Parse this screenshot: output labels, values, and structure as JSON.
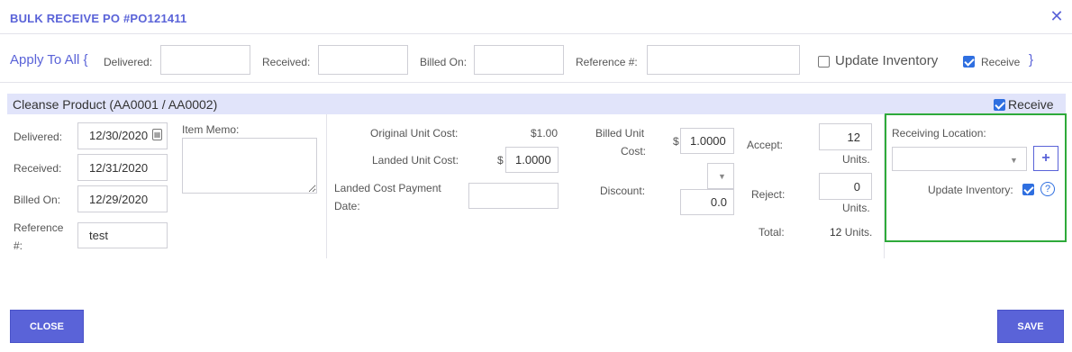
{
  "modal": {
    "title": "BULK RECEIVE PO #PO121411",
    "close_icon": "close-icon"
  },
  "apply_all": {
    "label": "Apply To All",
    "open_brace": "{",
    "close_brace": "}",
    "delivered_label": "Delivered:",
    "delivered_value": "",
    "received_label": "Received:",
    "received_value": "",
    "billed_on_label": "Billed On:",
    "billed_on_value": "",
    "reference_label": "Reference #:",
    "reference_value": "",
    "update_inventory_label": "Update Inventory",
    "update_inventory_checked": false,
    "receive_label": "Receive",
    "receive_checked": true
  },
  "product": {
    "title": "Cleanse Product (AA0001 / AA0002)",
    "receive_label": "Receive",
    "receive_checked": true,
    "delivered_label": "Delivered:",
    "delivered_value": "12/30/2020",
    "received_label": "Received:",
    "received_value": "12/31/2020",
    "billed_on_label": "Billed On:",
    "billed_on_value": "12/29/2020",
    "reference_label_1": "Reference",
    "reference_label_2": "#:",
    "reference_value": "test",
    "item_memo_label": "Item Memo:",
    "item_memo_value": "",
    "original_unit_cost_label": "Original Unit Cost:",
    "original_unit_cost_value": "$1.00",
    "landed_unit_cost_label": "Landed Unit Cost:",
    "landed_unit_cost_currency": "$",
    "landed_unit_cost_value": "1.0000",
    "landed_cost_payment_date_label_1": "Landed Cost Payment",
    "landed_cost_payment_date_label_2": "Date:",
    "landed_cost_payment_date_value": "",
    "billed_unit_cost_label_1": "Billed Unit",
    "billed_unit_cost_label_2": "Cost:",
    "billed_unit_cost_currency": "$",
    "billed_unit_cost_value": "1.0000",
    "discount_label": "Discount:",
    "discount_type": "",
    "discount_value": "0.0",
    "accept_label": "Accept:",
    "accept_value": "12",
    "accept_units": "Units.",
    "reject_label": "Reject:",
    "reject_value": "0",
    "reject_units": "Units.",
    "total_label": "Total:",
    "total_value": "12",
    "total_units": "Units.",
    "receiving_location_label": "Receiving Location:",
    "receiving_location_value": "",
    "add_location_icon": "plus-icon",
    "update_inventory_label": "Update Inventory:",
    "update_inventory_checked": true,
    "help_icon": "question-icon"
  },
  "footer": {
    "close_label": "CLOSE",
    "save_label": "SAVE"
  },
  "colors": {
    "accent": "#5a63d8",
    "product_bar": "#e1e4fa",
    "highlight_border": "#2eaa3a",
    "checkbox": "#2f6fe0"
  }
}
